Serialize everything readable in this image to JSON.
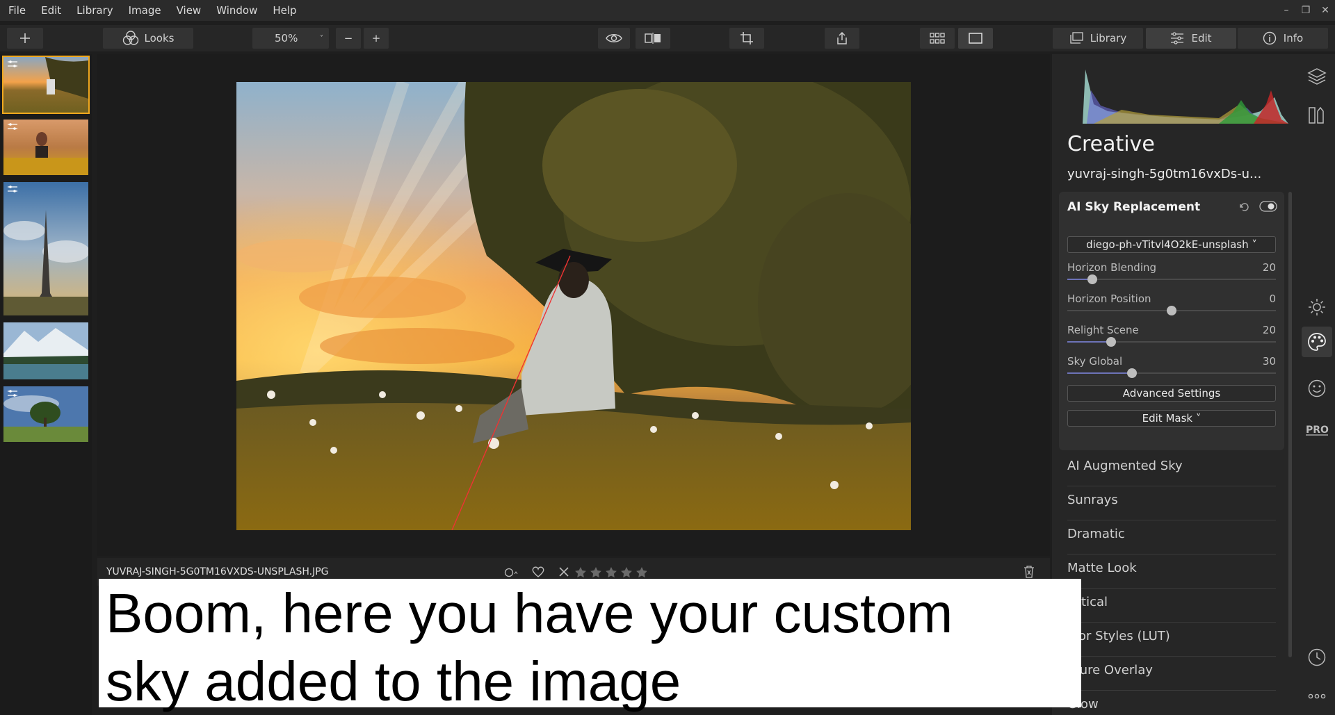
{
  "menu": [
    "File",
    "Edit",
    "Library",
    "Image",
    "View",
    "Window",
    "Help"
  ],
  "toolbar": {
    "looks_label": "Looks",
    "zoom": "50%",
    "zoom_minus": "−",
    "zoom_plus": "+",
    "mode_library": "Library",
    "mode_edit": "Edit",
    "mode_info": "Info"
  },
  "canvas": {
    "filename": "YUVRAJ-SINGH-5G0TM16VXDS-UNSPLASH.JPG"
  },
  "panel": {
    "title": "Creative",
    "file_name": "yuvraj-singh-5g0tm16vxDs-u...",
    "sky_replacement": {
      "title": "AI Sky Replacement",
      "sky_choice": "diego-ph-vTitvl4O2kE-unsplash ˅",
      "sliders": [
        {
          "label": "Horizon Blending",
          "value": "20",
          "fraction": 0.12
        },
        {
          "label": "Horizon Position",
          "value": "0",
          "fraction": 0.5
        },
        {
          "label": "Relight Scene",
          "value": "20",
          "fraction": 0.21
        },
        {
          "label": "Sky Global",
          "value": "30",
          "fraction": 0.31
        }
      ],
      "advanced_settings": "Advanced Settings",
      "edit_mask": "Edit Mask ˅"
    },
    "categories": [
      "AI Augmented Sky",
      "Sunrays",
      "Dramatic",
      "Matte Look",
      "ystical",
      "olor Styles (LUT)",
      "xture Overlay",
      "Glow"
    ]
  },
  "caption": {
    "line1": "Boom, here you have your custom",
    "line2": "sky added to the image"
  },
  "colors": {
    "accent": "#f0a81e",
    "slider_fill": "#6d73b8"
  }
}
